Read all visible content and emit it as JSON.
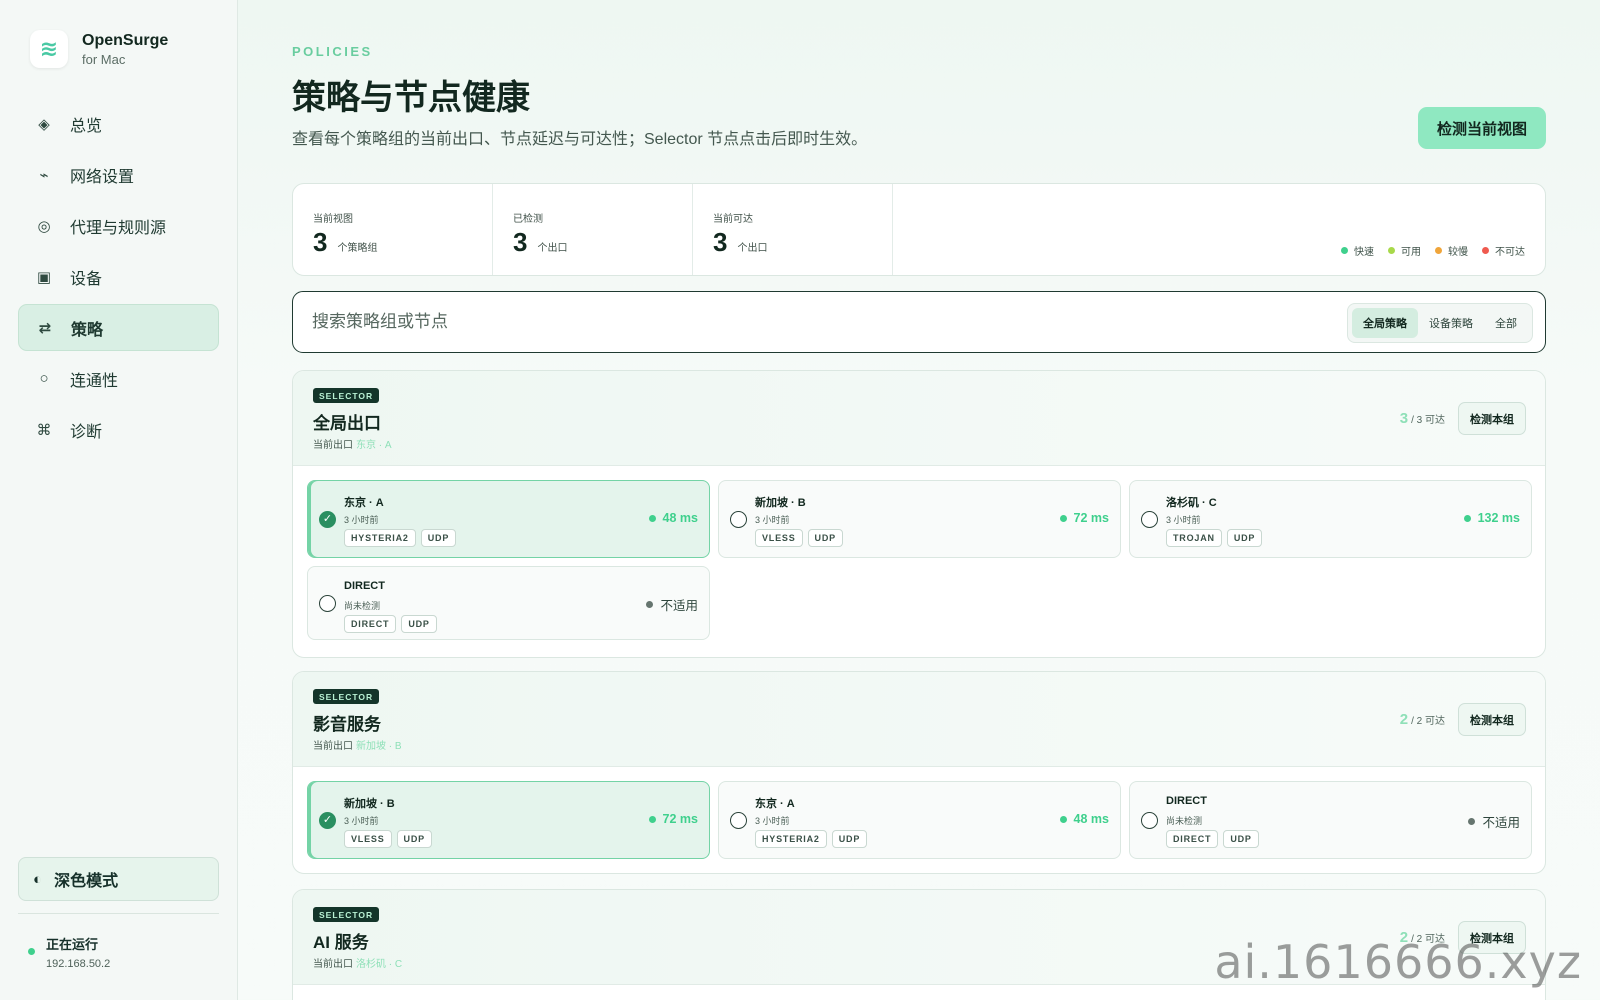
{
  "brand": {
    "name": "OpenSurge",
    "sub": "for Mac"
  },
  "nav": [
    {
      "icon": "◈",
      "label": "总览"
    },
    {
      "icon": "⌁",
      "label": "网络设置"
    },
    {
      "icon": "◎",
      "label": "代理与规则源"
    },
    {
      "icon": "▣",
      "label": "设备"
    },
    {
      "icon": "⇄",
      "label": "策略"
    },
    {
      "icon": "○",
      "label": "连通性"
    },
    {
      "icon": "⌘",
      "label": "诊断"
    }
  ],
  "nav_active": "策略",
  "dark_mode": {
    "icon": "◐",
    "label": "深色模式"
  },
  "status": {
    "title": "正在运行",
    "ip": "192.168.50.2"
  },
  "header": {
    "eyebrow": "POLICIES",
    "title": "策略与节点健康",
    "subtitle": "查看每个策略组的当前出口、节点延迟与可达性；Selector 节点点击后即时生效。",
    "check_button": "检测当前视图"
  },
  "stats": [
    {
      "label": "当前视图",
      "value": "3",
      "unit": "个策略组"
    },
    {
      "label": "已检测",
      "value": "3",
      "unit": "个出口"
    },
    {
      "label": "当前可达",
      "value": "3",
      "unit": "个出口"
    }
  ],
  "legend": [
    {
      "label": "快速",
      "color": "#3fd08d"
    },
    {
      "label": "可用",
      "color": "#a8d94a"
    },
    {
      "label": "较慢",
      "color": "#f0a53a"
    },
    {
      "label": "不可达",
      "color": "#ef5a4f"
    }
  ],
  "search": {
    "placeholder": "搜索策略组或节点",
    "segments": [
      "全局策略",
      "设备策略",
      "全部"
    ],
    "active_segment": "全局策略"
  },
  "groups": [
    {
      "badge": "SELECTOR",
      "name": "全局出口",
      "current_label": "当前出口",
      "current": "东京 · A",
      "reach_n": "3",
      "reach_rest": "/ 3 可达",
      "check_button": "检测本组",
      "nodes": [
        {
          "name": "东京 · A",
          "time": "3 小时前",
          "tags": [
            "HYSTERIA2",
            "UDP"
          ],
          "latency": "48 ms",
          "selected": true
        },
        {
          "name": "新加坡 · B",
          "time": "3 小时前",
          "tags": [
            "VLESS",
            "UDP"
          ],
          "latency": "72 ms",
          "selected": false
        },
        {
          "name": "洛杉矶 · C",
          "time": "3 小时前",
          "tags": [
            "TROJAN",
            "UDP"
          ],
          "latency": "132 ms",
          "selected": false
        },
        {
          "name": "DIRECT",
          "time": "尚未检测",
          "tags": [
            "DIRECT",
            "UDP"
          ],
          "latency": "不适用",
          "selected": false,
          "na": true
        }
      ]
    },
    {
      "badge": "SELECTOR",
      "name": "影音服务",
      "current_label": "当前出口",
      "current": "新加坡 · B",
      "reach_n": "2",
      "reach_rest": "/ 2 可达",
      "check_button": "检测本组",
      "nodes": [
        {
          "name": "新加坡 · B",
          "time": "3 小时前",
          "tags": [
            "VLESS",
            "UDP"
          ],
          "latency": "72 ms",
          "selected": true
        },
        {
          "name": "东京 · A",
          "time": "3 小时前",
          "tags": [
            "HYSTERIA2",
            "UDP"
          ],
          "latency": "48 ms",
          "selected": false
        },
        {
          "name": "DIRECT",
          "time": "尚未检测",
          "tags": [
            "DIRECT",
            "UDP"
          ],
          "latency": "不适用",
          "selected": false,
          "na": true
        }
      ]
    },
    {
      "badge": "SELECTOR",
      "name": "AI 服务",
      "current_label": "当前出口",
      "current": "洛杉矶 · C",
      "reach_n": "2",
      "reach_rest": "/ 2 可达",
      "check_button": "检测本组",
      "nodes": []
    }
  ],
  "watermark": "ai.1616666.xyz"
}
